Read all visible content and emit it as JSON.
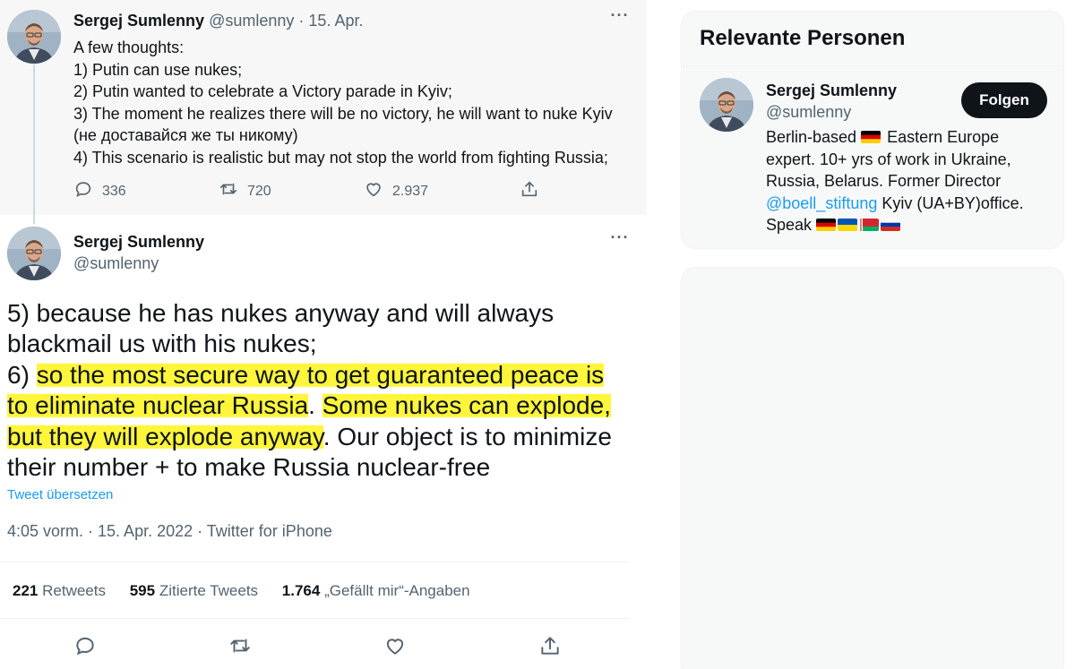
{
  "parent_tweet": {
    "name": "Sergej Sumlenny",
    "handle": "@sumlenny",
    "sep": "·",
    "date": "15. Apr.",
    "lines": [
      "A few thoughts:",
      "1) Putin can use nukes;",
      "2) Putin wanted to celebrate a Victory parade in Kyiv;",
      "3) The moment he realizes there will be no victory, he will want to nuke Kyiv",
      "(не доставайся же ты никому)",
      "4) This scenario is realistic but may not stop the world from fighting Russia;"
    ],
    "replies": "336",
    "retweets": "720",
    "likes": "2.937"
  },
  "main_tweet": {
    "name": "Sergej Sumlenny",
    "handle": "@sumlenny",
    "line1": "5) because he has nukes anyway and will always",
    "line2": "blackmail us with his nukes;",
    "line3_prefix": "6) ",
    "line3_hl": "so the most secure way to get guaranteed peace is",
    "line4_hl": "to eliminate nuclear Russia",
    "line4_plain": ". ",
    "line4_hl2": "Some nukes can explode,",
    "line5_hl": "but they will explode anyway",
    "line5_plain": ". Our object is to minimize",
    "line6": "their number + to make Russia nuclear-free",
    "translate": "Tweet übersetzen",
    "meta": "4:05 vorm. · 15. Apr. 2022 · Twitter for iPhone",
    "retweets_num": "221",
    "retweets_label": "Retweets",
    "quotes_num": "595",
    "quotes_label": "Zitierte Tweets",
    "likes_num": "1.764",
    "likes_label": "„Gefällt mir“-Angaben"
  },
  "sidebar": {
    "title": "Relevante Personen",
    "person": {
      "name": "Sergej Sumlenny",
      "handle": "@sumlenny",
      "follow_label": "Folgen",
      "bio_1a": "Berlin-based",
      "bio_1b": "Eastern Europe",
      "bio_2": "expert. 10+ yrs of work in Ukraine,",
      "bio_3": "Russia, Belarus. Former Director",
      "bio_link": "@boell_stiftung",
      "bio_4": " Kyiv (UA+BY)office.",
      "bio_5": "Speak"
    }
  },
  "colors": {
    "accent": "#1d9bf0",
    "highlight": "#fff63b",
    "muted": "#536471"
  }
}
